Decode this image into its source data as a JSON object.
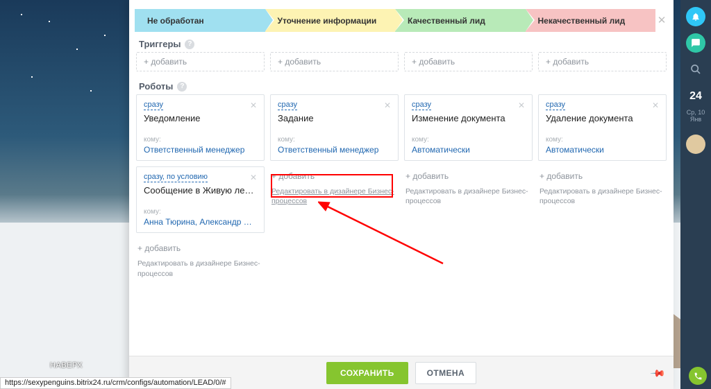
{
  "rail": {
    "day": "24",
    "date": "Ср, 10 Янв"
  },
  "top_link": "НАВЕРХ",
  "status_url": "https://sexypenguins.bitrix24.ru/crm/configs/automation/LEAD/0/#",
  "stages": [
    "Не обработан",
    "Уточнение информации",
    "Качественный лид",
    "Некачественный лид"
  ],
  "sections": {
    "triggers": "Триггеры",
    "robots": "Роботы"
  },
  "labels": {
    "add": "+ добавить",
    "to": "кому:",
    "designer": "Редактировать в дизайнере Бизнес-процессов",
    "immediately": "сразу",
    "immediately_cond": "сразу, по условию"
  },
  "robots": {
    "col1": [
      {
        "trigger": "сразу",
        "title": "Уведомление",
        "to": "Ответственный менеджер"
      },
      {
        "trigger": "сразу, по условию",
        "title": "Сообщение в Живую ленту",
        "to": "Анна Тюрина, Александр Ра..."
      }
    ],
    "col2": [
      {
        "trigger": "сразу",
        "title": "Задание",
        "to": "Ответственный менеджер"
      }
    ],
    "col3": [
      {
        "trigger": "сразу",
        "title": "Изменение документа",
        "to": "Автоматически"
      }
    ],
    "col4": [
      {
        "trigger": "сразу",
        "title": "Удаление документа",
        "to": "Автоматически"
      }
    ]
  },
  "footer": {
    "save": "СОХРАНИТЬ",
    "cancel": "ОТМЕНА"
  }
}
